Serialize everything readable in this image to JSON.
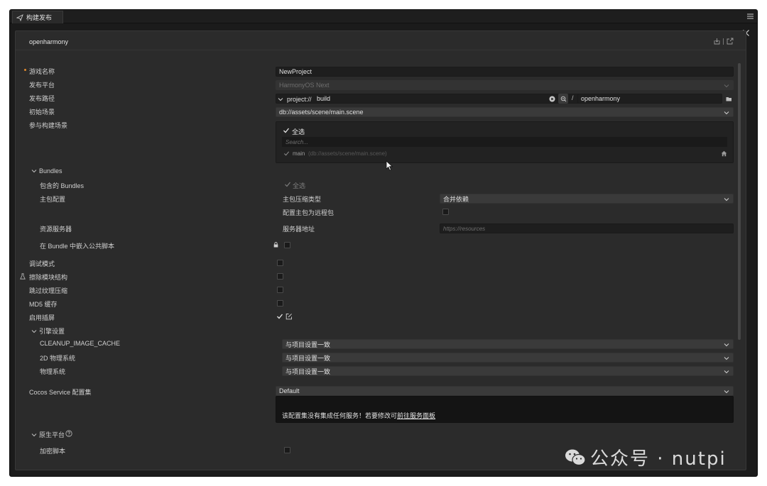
{
  "window": {
    "tab_title": "构建发布",
    "platform_title": "openharmony"
  },
  "fields": {
    "game_name": {
      "label": "游戏名称",
      "value": "NewProject"
    },
    "platform": {
      "label": "发布平台",
      "value": "HarmonyOS Next"
    },
    "path": {
      "label": "发布路径",
      "prefix": "project://",
      "value": "build",
      "separator": "/",
      "suffix_value": "openharmony"
    },
    "start_scene": {
      "label": "初始场景",
      "value": "db://assets/scene/main.scene"
    },
    "build_scenes": {
      "label": "参与构建场景",
      "select_all": "全选",
      "search_placeholder": "Search...",
      "items": [
        {
          "name": "main",
          "path": "(db://assets/scene/main.scene)"
        }
      ]
    }
  },
  "bundles": {
    "title": "Bundles",
    "included_label": "包含的 Bundles",
    "included_select_all": "全选",
    "main_config_label": "主包配置",
    "compress_type_label": "主包压缩类型",
    "compress_type_value": "合并依赖",
    "remote_label": "配置主包为远程包",
    "resource_server_label": "资源服务器",
    "server_address_label": "服务器地址",
    "server_address_placeholder": "https://resources",
    "embed_script_label": "在 Bundle 中嵌入公共脚本"
  },
  "options": {
    "debug_label": "调试模式",
    "erase_modules_label": "擦除模块结构",
    "skip_texture_label": "跳过纹理压缩",
    "md5_label": "MD5 缓存",
    "splash_label": "启用插屏"
  },
  "engine": {
    "title": "引擎设置",
    "rows": [
      {
        "label": "CLEANUP_IMAGE_CACHE",
        "value": "与项目设置一致"
      },
      {
        "label": "2D 物理系统",
        "value": "与项目设置一致"
      },
      {
        "label": "物理系统",
        "value": "与项目设置一致"
      }
    ]
  },
  "cocos_service": {
    "label": "Cocos Service 配置集",
    "value": "Default",
    "notice": "该配置集没有集成任何服务！若要修改可",
    "notice_link": "前往服务面板"
  },
  "native": {
    "title": "原生平台",
    "encrypt_label": "加密脚本"
  },
  "watermark": {
    "text": "公众号 · nutpi"
  }
}
